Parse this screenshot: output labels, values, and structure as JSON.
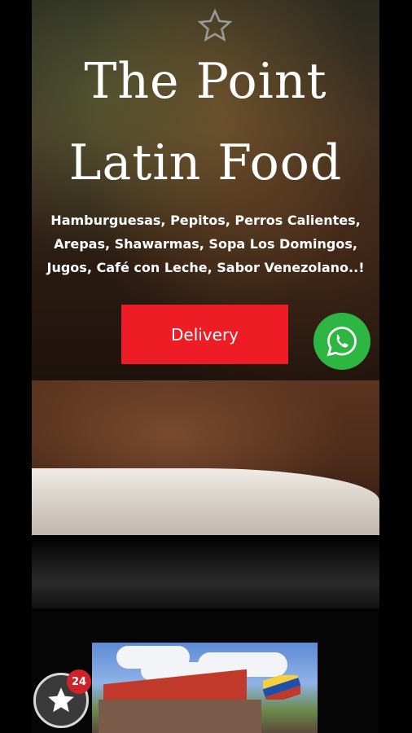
{
  "hero": {
    "title_line1": "The Point",
    "title_line2": "Latin Food",
    "tagline_line1": "Hamburguesas, Pepitos, Perros Calientes,",
    "tagline_line2": "Arepas, Shawarmas, Sopa Los Domingos,",
    "tagline_line3": "Jugos, Café con Leche, Sabor Venezolano..!",
    "delivery_label": "Delivery",
    "top_icon": "star-outline-icon"
  },
  "floating": {
    "whatsapp_icon": "whatsapp-icon",
    "rating_icon": "star-icon",
    "rating_count": "24"
  },
  "colors": {
    "delivery": "#ee1c24",
    "whatsapp": "#2db742",
    "badge": "#d0222b"
  }
}
